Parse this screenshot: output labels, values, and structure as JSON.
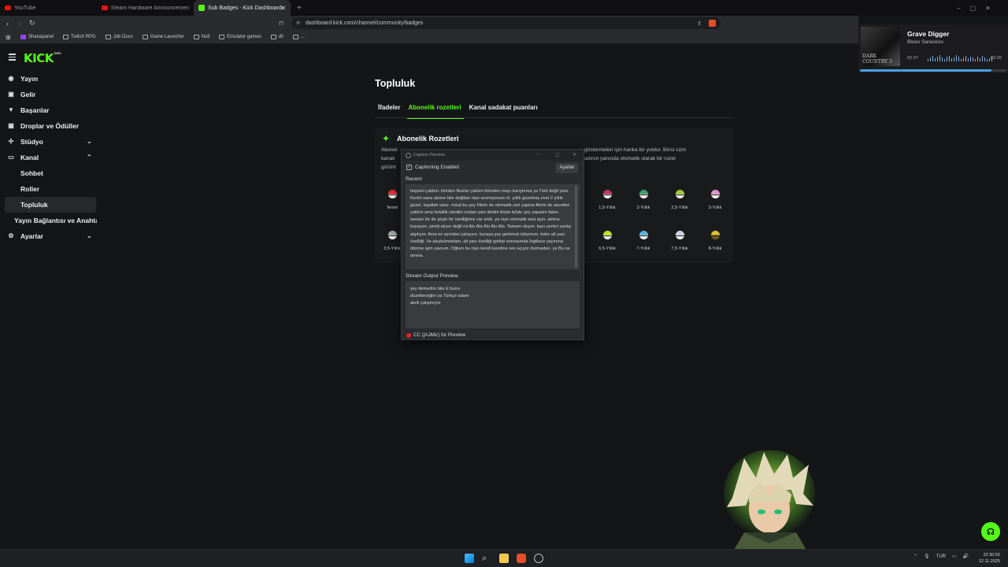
{
  "browser": {
    "tabs": [
      {
        "label": "YouTube",
        "active": false
      },
      {
        "label": "Steam Hardware Announcement - Yo",
        "active": false
      },
      {
        "label": "Sub Badges - Kick Dashboard",
        "active": true
      }
    ],
    "url": "dashboard.kick.com/channel/community/badges",
    "bookmarks": [
      "Shanapanel",
      "Twitch RPG",
      "Job Docs",
      "Game Launcher",
      "Null",
      "Emulator games",
      "dil",
      "..."
    ]
  },
  "kick": {
    "logo": "KICK",
    "logo_sup": "beta",
    "accent": "#53fc18"
  },
  "sidebar": {
    "items": [
      {
        "label": "Yayın",
        "icon": "broadcast-icon"
      },
      {
        "label": "Gelir",
        "icon": "revenue-icon"
      },
      {
        "label": "Başarılar",
        "icon": "trophy-icon"
      },
      {
        "label": "Droplar ve Ödüller",
        "icon": "gift-icon"
      },
      {
        "label": "Stüdyo",
        "icon": "studio-icon"
      },
      {
        "label": "Kanal",
        "icon": "channel-icon"
      },
      {
        "label": "Sohbet"
      },
      {
        "label": "Roller"
      },
      {
        "label": "Topluluk"
      },
      {
        "label": "Yayın Bağlantısı ve Anahtar"
      },
      {
        "label": "Ayarlar",
        "icon": "gear-icon"
      }
    ]
  },
  "main": {
    "title": "Topluluk",
    "tabs": [
      "İfadeler",
      "Abonelik rozetleri",
      "Kanal sadakat puanları"
    ],
    "card_title": "Abonelik Rozetleri",
    "desc_left": [
      "Abonel",
      "kanalı",
      "görünt"
    ],
    "desc_right_1": "göstermeleri için harika bir yoldur. Birisi sizin",
    "desc_right_2": "adının yanında otomatik olarak bir rozet",
    "badges": [
      {
        "label": "Temel"
      },
      {
        "label": "1,5-Yıllık"
      },
      {
        "label": "2-Yıllık"
      },
      {
        "label": "2,5-Yıllık"
      },
      {
        "label": "3-Yıllık"
      },
      {
        "label": "3,5-Yıllık"
      },
      {
        "label": "6,5-Yıllık"
      },
      {
        "label": "7-Yıllık"
      },
      {
        "label": "7,5-Yıllık"
      },
      {
        "label": "8-Yıllık"
      }
    ]
  },
  "caption_window": {
    "title": "Caption Preview",
    "enabled_label": "Captioning Enabled",
    "settings_button": "Ayarlar",
    "recent_label": "Recent:",
    "recent_text": "hepsini çaldım. kimden Bunlar çaldım birinden orayı karıştırma ya Türk değil yani. Kerim sana abone bile değilsin niye seviniyorsun ki. yıllık güzelmiş evet 2 yıllık güzel. inşallah vanz. misal bu şey Fikrin de otomatik sort yapma fikrini de atarıden çaldım ama helallik istedim ondan yani dedim böyle böyle şey yapalım falan. tamam bir de şöyle bir özelliğimiz var artık. ya niye otomatik sesi açın. amina koyayım, şimdi alıyor değil mi Alo Alo Alo Alo Alo. Tamam oluyor. bazı yerleri yanlış algılıyor. Ama en azından çalışıyor. buraya şey getirmek istiyorum. keke alt yazı özelliği. Ve aleykümselam, alt yazı özelliği getirip sonrasında İngilizce yayınına dönme işim yavrum. Oğlum bu niye kendi kendine ses açıyor durmadan. ya Bu ne amına.",
    "output_label": "Stream Output Preview:",
    "output_lines": [
      "şey demedim bile E bunu",
      "düzelteceğim ya Türkçe adam",
      "akıllı çalışmıyor"
    ],
    "status": "CC ([AJMic) for Preview"
  },
  "media": {
    "title": "Grave Digger",
    "artist": "Blues Saraceno",
    "album_text": "DARK COUNTRY 3",
    "elapsed": "02:37",
    "total": "03:35",
    "progress": 0.9
  },
  "taskbar": {
    "lang": "TUR",
    "time": "22:30:52",
    "date": "12.11.2025"
  }
}
